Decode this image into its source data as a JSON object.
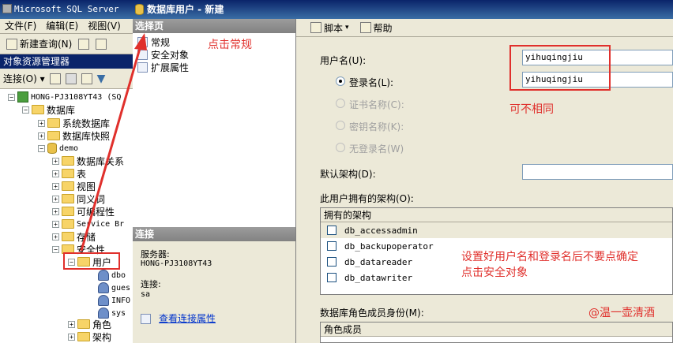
{
  "ssms": {
    "title": "Microsoft SQL Server",
    "menu": [
      "文件(F)",
      "编辑(E)",
      "视图(V)"
    ],
    "toolbar": {
      "new_query": "新建查询(N)"
    },
    "object_explorer": {
      "header": "对象资源管理器",
      "connect": "连接(O) ▾"
    },
    "tree": {
      "server": "HONG-PJ3108YT43 (SQ",
      "databases": "数据库",
      "system_databases": "系统数据库",
      "database_snapshots": "数据库快照",
      "demo": "demo",
      "demo_children": [
        "数据库关系",
        "表",
        "视图",
        "同义词",
        "可编程性",
        "Service Br",
        "存储",
        "安全性"
      ],
      "users": "用户",
      "user_items": [
        "dbo",
        "gues",
        "INFO",
        "sys"
      ],
      "roles": "角色",
      "schemas": "架构"
    }
  },
  "dialog": {
    "title": "数据库用户 - 新建",
    "select_page_header": "选择页",
    "pages": [
      "常规",
      "安全对象",
      "扩展属性"
    ],
    "connection_header": "连接",
    "server_label": "服务器:",
    "server_value": "HONG-PJ3108YT43",
    "connection_label": "连接:",
    "connection_value": "sa",
    "view_connection_props": "查看连接属性",
    "toolbar": {
      "script": "脚本",
      "help": "帮助"
    },
    "username_label": "用户名(U):",
    "username_value": "yihuqingjiu",
    "login_name_label": "登录名(L):",
    "login_name_value": "yihuqingjiu",
    "cert_name_label": "证书名称(C):",
    "key_name_label": "密钥名称(K):",
    "no_login_label": "无登录名(W)",
    "default_schema_label": "默认架构(D):",
    "owned_schemas_label": "此用户拥有的架构(O):",
    "owned_schemas_header": "拥有的架构",
    "owned_schemas": [
      "db_accessadmin",
      "db_backupoperator",
      "db_datareader",
      "db_datawriter"
    ],
    "role_membership_label": "数据库角色成员身份(M):",
    "role_members_header": "角色成员"
  },
  "annotations": {
    "click_general": "点击常规",
    "can_differ": "可不相同",
    "note_line1": "设置好用户名和登录名后不要点确定",
    "note_line2": "点击安全对象",
    "watermark": "@温一壶清酒"
  },
  "colors": {
    "annotation_red": "#e0302c",
    "title_bar": "#0a246a"
  }
}
